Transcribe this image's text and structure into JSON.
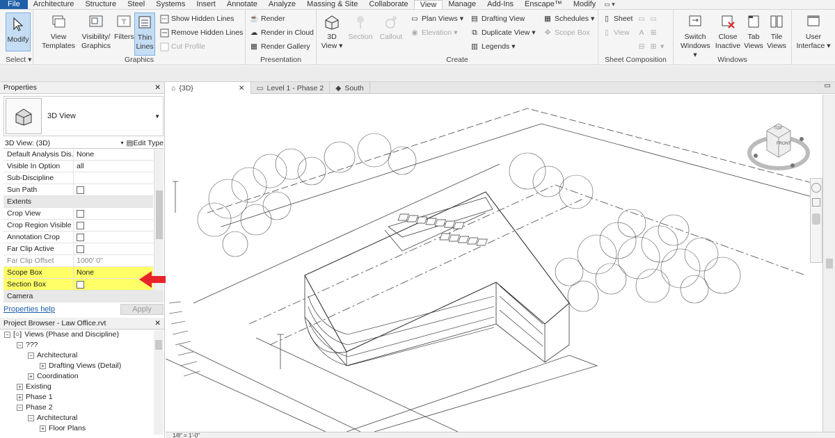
{
  "menu": {
    "tabs": [
      "File",
      "Architecture",
      "Structure",
      "Steel",
      "Systems",
      "Insert",
      "Annotate",
      "Analyze",
      "Massing & Site",
      "Collaborate",
      "View",
      "Manage",
      "Add-Ins",
      "Enscape™",
      "Modify"
    ],
    "active": "View"
  },
  "ribbon": {
    "select": {
      "modify": "Modify",
      "panel": "Select"
    },
    "graphics": {
      "panel": "Graphics",
      "view_templates": [
        "View",
        "Templates"
      ],
      "visibility": [
        "Visibility/",
        "Graphics"
      ],
      "filters": "Filters",
      "thin_lines": [
        "Thin",
        "Lines"
      ],
      "show_hidden": "Show  Hidden Lines",
      "remove_hidden": "Remove  Hidden Lines",
      "cut_profile": "Cut  Profile"
    },
    "presentation": {
      "panel": "Presentation",
      "render": "Render",
      "render_cloud": "Render  in Cloud",
      "render_gallery": "Render  Gallery"
    },
    "create": {
      "panel": "Create",
      "view3d": [
        "3D",
        "View"
      ],
      "section": "Section",
      "callout": "Callout",
      "plan_views": "Plan  Views",
      "elevation": "Elevation",
      "drafting_view": "Drafting  View",
      "duplicate_view": "Duplicate  View",
      "legends": "Legends",
      "schedules": "Schedules",
      "scope_box": "Scope  Box"
    },
    "sheet": {
      "panel": "Sheet Composition",
      "sheet": "Sheet",
      "view": "View"
    },
    "windows": {
      "panel": "Windows",
      "switch": [
        "Switch",
        "Windows"
      ],
      "close": [
        "Close",
        "Inactive"
      ],
      "tab": [
        "Tab",
        "Views"
      ],
      "tile": [
        "Tile",
        "Views"
      ]
    },
    "ui": [
      "User",
      "Interface"
    ]
  },
  "properties": {
    "title": "Properties",
    "type_name": "3D View",
    "selector": "3D View: (3D)",
    "edit_type": "Edit Type",
    "rows": [
      {
        "k": "Default Analysis Dis...",
        "v": "None"
      },
      {
        "k": "Visible In Option",
        "v": "all"
      },
      {
        "k": "Sub-Discipline",
        "v": ""
      },
      {
        "k": "Sun Path",
        "v": ""
      },
      {
        "k": "Extents",
        "v": ""
      },
      {
        "k": "Crop View",
        "v": ""
      },
      {
        "k": "Crop Region Visible",
        "v": ""
      },
      {
        "k": "Annotation Crop",
        "v": ""
      },
      {
        "k": "Far Clip Active",
        "v": ""
      },
      {
        "k": "Far Clip Offset",
        "v": "1000'  0\""
      },
      {
        "k": "Scope Box",
        "v": "None"
      },
      {
        "k": "Section Box",
        "v": ""
      },
      {
        "k": "Camera",
        "v": ""
      }
    ],
    "help": "Properties help",
    "apply": "Apply"
  },
  "browser": {
    "title": "Project Browser - Law Office.rvt",
    "nodes": [
      {
        "label": "Views (Phase and Discipline)",
        "tog": "−"
      },
      {
        "label": "???",
        "tog": "−"
      },
      {
        "label": "Architectural",
        "tog": "−"
      },
      {
        "label": "Drafting Views (Detail)",
        "tog": "+"
      },
      {
        "label": "Coordination",
        "tog": "+"
      },
      {
        "label": "Existing",
        "tog": "+"
      },
      {
        "label": "Phase 1",
        "tog": "+"
      },
      {
        "label": "Phase 2",
        "tog": "−"
      },
      {
        "label": "Architectural",
        "tog": "−"
      },
      {
        "label": "Floor Plans",
        "tog": "+"
      }
    ]
  },
  "view_tabs": [
    {
      "label": "{3D}",
      "active": true
    },
    {
      "label": "Level 1 - Phase 2",
      "active": false
    },
    {
      "label": "South",
      "active": false
    }
  ],
  "viewcube": {
    "top": "TOP",
    "front": "FRONT"
  },
  "status": {
    "scale": "1/8\" = 1'-0\""
  },
  "colors": {
    "highlight": "#ffff66",
    "arrow": "#e8232a",
    "accent": "#1e5fa8"
  }
}
